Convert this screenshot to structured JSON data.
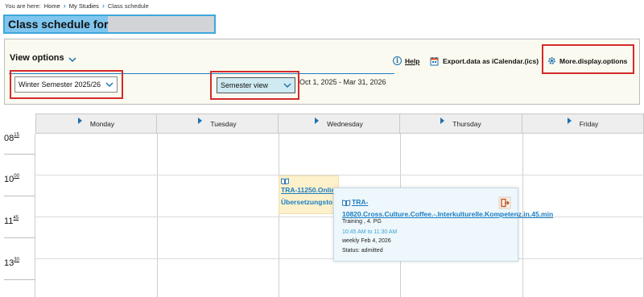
{
  "breadcrumb": {
    "prefix": "You are here:",
    "items": [
      "Home",
      "My Studies",
      "Class schedule"
    ]
  },
  "page": {
    "title": "Class schedule for"
  },
  "view_options": {
    "title": "View options",
    "semester_select": {
      "value": "Winter Semester 2025/26"
    },
    "view_select": {
      "value": "Semester view"
    },
    "date_range": "Oct 1, 2025 - Mar 31, 2026",
    "help_label": "Help",
    "export_label": "Export.data as iCalendar.(ics)",
    "more_label": "More.display.options"
  },
  "calendar": {
    "days": [
      "Monday",
      "Tuesday",
      "Wednesday",
      "Thursday",
      "Friday"
    ],
    "times": [
      {
        "hour": "08",
        "min": "15"
      },
      {
        "hour": "10",
        "min": "00"
      },
      {
        "hour": "11",
        "min": "45"
      },
      {
        "hour": "13",
        "min": "30"
      }
    ],
    "event": {
      "line1": "TRA-11250.Onlin",
      "line2": "Übersetzungsto"
    }
  },
  "popup": {
    "title": "TRA-10820.Cross.Culture.Coffee.-.Interkulturelle.Kompetenz.in.45.min",
    "type": "Training , 4. PG",
    "time": "10:45 AM to 11:30 AM",
    "date": "weekly Feb 4, 2026",
    "status": "Status: admitted"
  },
  "colors": {
    "accent": "#1a7ec4",
    "highlight": "#d42a2a",
    "event_bg": "#fdf1cc",
    "popup_bg": "#eef7fb"
  }
}
